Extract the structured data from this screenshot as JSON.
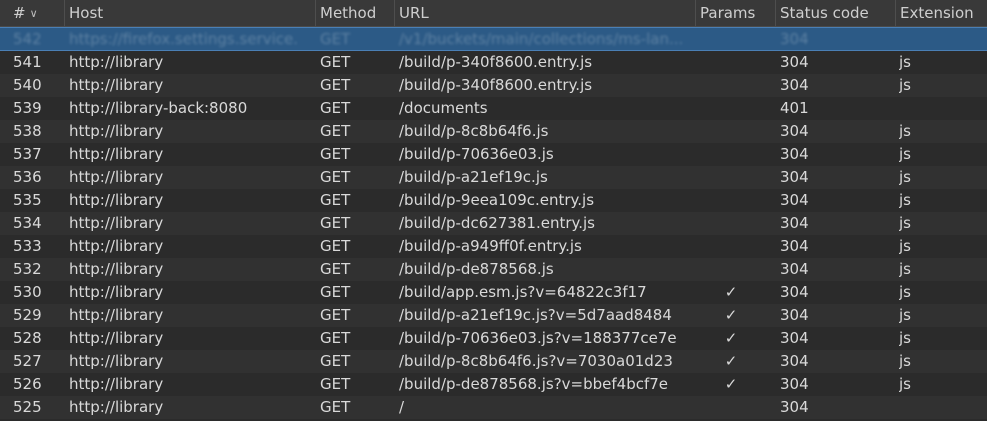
{
  "columns": {
    "num": "#",
    "host": "Host",
    "method": "Method",
    "url": "URL",
    "params": "Params",
    "status": "Status code",
    "extension": "Extension"
  },
  "selected_row": {
    "num": "542",
    "host": "https://firefox.settings.service...",
    "method": "GET",
    "url": "/v1/buckets/main/collections/ms-lan...",
    "params": "",
    "status": "304",
    "extension": ""
  },
  "rows": [
    {
      "num": "541",
      "host": "http://library",
      "method": "GET",
      "url": "/build/p-340f8600.entry.js",
      "params": "",
      "status": "304",
      "extension": "js"
    },
    {
      "num": "540",
      "host": "http://library",
      "method": "GET",
      "url": "/build/p-340f8600.entry.js",
      "params": "",
      "status": "304",
      "extension": "js"
    },
    {
      "num": "539",
      "host": "http://library-back:8080",
      "method": "GET",
      "url": "/documents",
      "params": "",
      "status": "401",
      "extension": ""
    },
    {
      "num": "538",
      "host": "http://library",
      "method": "GET",
      "url": "/build/p-8c8b64f6.js",
      "params": "",
      "status": "304",
      "extension": "js"
    },
    {
      "num": "537",
      "host": "http://library",
      "method": "GET",
      "url": "/build/p-70636e03.js",
      "params": "",
      "status": "304",
      "extension": "js"
    },
    {
      "num": "536",
      "host": "http://library",
      "method": "GET",
      "url": "/build/p-a21ef19c.js",
      "params": "",
      "status": "304",
      "extension": "js"
    },
    {
      "num": "535",
      "host": "http://library",
      "method": "GET",
      "url": "/build/p-9eea109c.entry.js",
      "params": "",
      "status": "304",
      "extension": "js"
    },
    {
      "num": "534",
      "host": "http://library",
      "method": "GET",
      "url": "/build/p-dc627381.entry.js",
      "params": "",
      "status": "304",
      "extension": "js"
    },
    {
      "num": "533",
      "host": "http://library",
      "method": "GET",
      "url": "/build/p-a949ff0f.entry.js",
      "params": "",
      "status": "304",
      "extension": "js"
    },
    {
      "num": "532",
      "host": "http://library",
      "method": "GET",
      "url": "/build/p-de878568.js",
      "params": "",
      "status": "304",
      "extension": "js"
    },
    {
      "num": "530",
      "host": "http://library",
      "method": "GET",
      "url": "/build/app.esm.js?v=64822c3f17",
      "params": "✓",
      "status": "304",
      "extension": "js"
    },
    {
      "num": "529",
      "host": "http://library",
      "method": "GET",
      "url": "/build/p-a21ef19c.js?v=5d7aad8484",
      "params": "✓",
      "status": "304",
      "extension": "js"
    },
    {
      "num": "528",
      "host": "http://library",
      "method": "GET",
      "url": "/build/p-70636e03.js?v=188377ce7e",
      "params": "✓",
      "status": "304",
      "extension": "js"
    },
    {
      "num": "527",
      "host": "http://library",
      "method": "GET",
      "url": "/build/p-8c8b64f6.js?v=7030a01d23",
      "params": "✓",
      "status": "304",
      "extension": "js"
    },
    {
      "num": "526",
      "host": "http://library",
      "method": "GET",
      "url": "/build/p-de878568.js?v=bbef4bcf7e",
      "params": "✓",
      "status": "304",
      "extension": "js"
    },
    {
      "num": "525",
      "host": "http://library",
      "method": "GET",
      "url": "/",
      "params": "",
      "status": "304",
      "extension": ""
    }
  ],
  "colors": {
    "background": "#2b2b2b",
    "header": "#393939",
    "selection": "#2c5a86",
    "text": "#d9d9d9"
  },
  "icons": {
    "sort": "chevron-down-icon",
    "params_flag": "check-icon"
  }
}
